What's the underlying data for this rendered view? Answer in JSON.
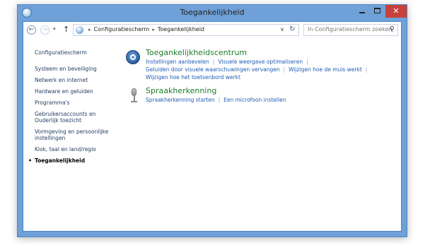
{
  "window": {
    "title": "Toegankelijkheid",
    "close_glyph": "✕"
  },
  "nav": {
    "back_glyph": "←",
    "forward_glyph": "→",
    "recent_glyph": "▾",
    "up_glyph": "↑",
    "breadcrumb": [
      "Configuratiescherm",
      "Toegankelijkheid"
    ],
    "breadcrumb_sep": "▸",
    "dropdown_glyph": "∨",
    "refresh_glyph": "↻",
    "search_placeholder": "In Configuratiescherm zoeken",
    "search_glyph": "⚲"
  },
  "sidebar": {
    "home": "Configuratiescherm",
    "items": [
      "Systeem en beveiliging",
      "Netwerk en internet",
      "Hardware en geluiden",
      "Programma's",
      "Gebruikersaccounts en Ouderlijk toezicht",
      "Vormgeving en persoonlijke instellingen",
      "Klok, taal en land/regio",
      "Toegankelijkheid"
    ],
    "active_bullet": "•"
  },
  "categories": [
    {
      "title": "Toegankelijkheidscentrum",
      "icon": "accessibility-icon",
      "links_row1": [
        "Instellingen aanbevelen",
        "Visuele weergave optimaliseren"
      ],
      "links_row2": [
        "Geluiden door visuele waarschuwingen vervangen",
        "Wijzigen hoe de muis werkt"
      ],
      "links_row3": [
        "Wijzigen hoe het toetsenbord werkt"
      ]
    },
    {
      "title": "Spraakherkenning",
      "icon": "microphone-icon",
      "links_row1": [
        "Spraakherkenning starten",
        "Een microfoon instellen"
      ]
    }
  ],
  "colors": {
    "frame": "#6fa0d8",
    "close_button": "#c7413c",
    "category_title": "#1d7c2a",
    "link": "#1c5cb5"
  }
}
